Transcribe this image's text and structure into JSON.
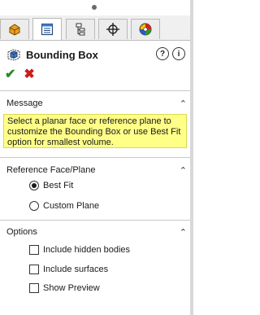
{
  "property_manager": {
    "title": "Bounding Box",
    "title_icon": "bounding-box-icon",
    "help_icon": "help-icon",
    "detail_icon": "info-icon",
    "ok_glyph": "✔",
    "cancel_glyph": "✖"
  },
  "tabs": [
    {
      "icon": "feature-manager-icon"
    },
    {
      "icon": "property-manager-icon",
      "active": true
    },
    {
      "icon": "configuration-manager-icon"
    },
    {
      "icon": "dimxpert-manager-icon"
    },
    {
      "icon": "display-manager-icon"
    }
  ],
  "message": {
    "header": "Message",
    "text": "Select a planar face or reference plane to customize the Bounding Box or use Best Fit option for smallest volume."
  },
  "reference": {
    "header": "Reference Face/Plane",
    "options": [
      {
        "label": "Best Fit",
        "selected": true
      },
      {
        "label": "Custom Plane",
        "selected": false
      }
    ]
  },
  "options": {
    "header": "Options",
    "items": [
      {
        "label": "Include hidden bodies",
        "checked": false
      },
      {
        "label": "Include surfaces",
        "checked": false
      },
      {
        "label": "Show Preview",
        "checked": false
      }
    ]
  },
  "colors": {
    "message_background": "#ffff88",
    "ok_green": "#2a8a2a",
    "cancel_red": "#c81e1e"
  }
}
